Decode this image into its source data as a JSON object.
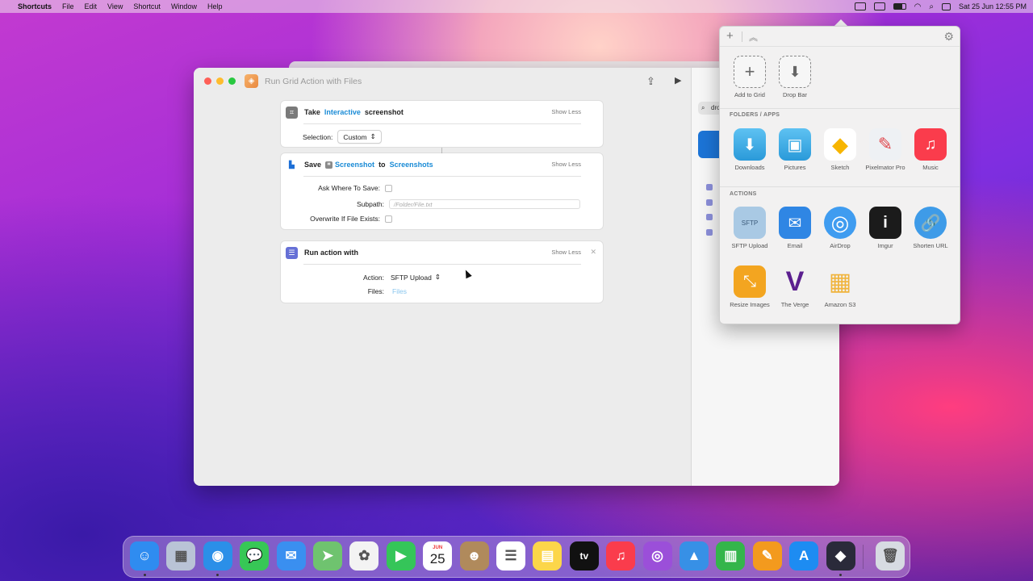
{
  "menubar": {
    "apple": "",
    "app_name": "Shortcuts",
    "menus": [
      "File",
      "Edit",
      "View",
      "Shortcut",
      "Window",
      "Help"
    ],
    "clock": "Sat 25 Jun  12:55 PM"
  },
  "window": {
    "title": "Run Grid Action with Files",
    "actions": [
      {
        "verb": "Take",
        "token": "Interactive",
        "noun": "screenshot",
        "show_less": "Show Less",
        "selection_label": "Selection:",
        "selection_value": "Custom"
      },
      {
        "verb": "Save",
        "token1": "Screenshot",
        "joiner": "to",
        "token2": "Screenshots",
        "show_less": "Show Less",
        "ask_label": "Ask Where To Save:",
        "subpath_label": "Subpath:",
        "subpath_placeholder": "/Folder/File.txt",
        "overwrite_label": "Overwrite If File Exists:"
      },
      {
        "title": "Run action with",
        "show_less": "Show Less",
        "action_label": "Action:",
        "action_value": "SFTP Upload",
        "files_label": "Files:",
        "files_value": "Files"
      }
    ],
    "search_text": "dro"
  },
  "dropzone": {
    "top": [
      {
        "label": "Add to Grid",
        "icon": "plus-dashed-icon"
      },
      {
        "label": "Drop Bar",
        "icon": "download-dashed-icon"
      }
    ],
    "folders_header": "FOLDERS / APPS",
    "folders": [
      {
        "label": "Downloads",
        "icon": "downloads-folder-icon",
        "color": "#3fa9e6"
      },
      {
        "label": "Pictures",
        "icon": "pictures-folder-icon",
        "color": "#3fa9e6"
      },
      {
        "label": "Sketch",
        "icon": "sketch-icon",
        "color": "#f7b500"
      },
      {
        "label": "Pixelmator Pro",
        "icon": "pixelmator-icon",
        "color": "#e9eef2"
      },
      {
        "label": "Music",
        "icon": "music-icon",
        "color": "#fa3c4c"
      }
    ],
    "actions_header": "ACTIONS",
    "actions": [
      {
        "label": "SFTP Upload",
        "icon": "sftp-icon",
        "glyph": "SFTP",
        "color": "#9ec3e0"
      },
      {
        "label": "Email",
        "icon": "mail-icon",
        "glyph": "✉",
        "color": "#2f86e4"
      },
      {
        "label": "AirDrop",
        "icon": "airdrop-icon",
        "glyph": "◎",
        "color": "#3f9cf0"
      },
      {
        "label": "Imgur",
        "icon": "imgur-icon",
        "glyph": "i",
        "color": "#1b1b1b"
      },
      {
        "label": "Shorten URL",
        "icon": "link-icon",
        "glyph": "🔗",
        "color": "#3e9be8"
      },
      {
        "label": "Resize Images",
        "icon": "resize-icon",
        "glyph": "⤡",
        "color": "#f3a520"
      },
      {
        "label": "The Verge",
        "icon": "verge-icon",
        "glyph": "V",
        "color": "#ffffff"
      },
      {
        "label": "Amazon S3",
        "icon": "s3-icon",
        "glyph": "▦",
        "color": "#f0b33b"
      }
    ]
  },
  "dock": [
    {
      "name": "finder",
      "glyph": "☺",
      "color": "#2f8cf0",
      "running": true
    },
    {
      "name": "launchpad",
      "glyph": "▦",
      "color": "#b9c3d6",
      "running": false
    },
    {
      "name": "safari",
      "glyph": "◉",
      "color": "#2b8fe8",
      "running": true
    },
    {
      "name": "messages",
      "glyph": "💬",
      "color": "#37c756",
      "running": false
    },
    {
      "name": "mail",
      "glyph": "✉",
      "color": "#3a8ff0",
      "running": false
    },
    {
      "name": "maps",
      "glyph": "➤",
      "color": "#6fc36f",
      "running": false
    },
    {
      "name": "photos",
      "glyph": "✿",
      "color": "#f3f3f3",
      "running": false
    },
    {
      "name": "facetime",
      "glyph": "▶",
      "color": "#35c559",
      "running": false
    },
    {
      "name": "calendar",
      "glyph": "25",
      "month": "JUN",
      "color": "#ffffff",
      "running": false
    },
    {
      "name": "contacts",
      "glyph": "☻",
      "color": "#b08a5c",
      "running": false
    },
    {
      "name": "reminders",
      "glyph": "☰",
      "color": "#ffffff",
      "running": false
    },
    {
      "name": "notes",
      "glyph": "▤",
      "color": "#fcd64a",
      "running": false
    },
    {
      "name": "tv",
      "glyph": "tv",
      "color": "#111111",
      "running": false
    },
    {
      "name": "music",
      "glyph": "♫",
      "color": "#fa3c4c",
      "running": false
    },
    {
      "name": "podcasts",
      "glyph": "◎",
      "color": "#9b4fd9",
      "running": false
    },
    {
      "name": "keynote",
      "glyph": "▲",
      "color": "#3790e6",
      "running": false
    },
    {
      "name": "numbers",
      "glyph": "▥",
      "color": "#34b54b",
      "running": false
    },
    {
      "name": "pages",
      "glyph": "✎",
      "color": "#f39a1e",
      "running": false
    },
    {
      "name": "app-store",
      "glyph": "A",
      "color": "#1d8cf2",
      "running": false
    },
    {
      "name": "shortcuts",
      "glyph": "◆",
      "color": "#2a2a3a",
      "running": true
    },
    {
      "name": "trash",
      "glyph": "🗑",
      "color": "#d7dbe2",
      "running": false
    }
  ]
}
